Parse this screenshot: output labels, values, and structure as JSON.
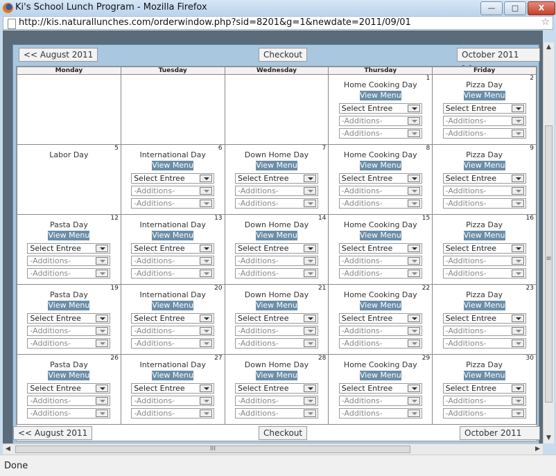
{
  "window": {
    "title": "Ki's School Lunch Program - Mozilla Firefox",
    "url": "http://kis.naturallunches.com/orderwindow.php?sid=8201&g=1&newdate=2011/09/01",
    "minimize_label": "—",
    "maximize_label": "□",
    "close_label": "X"
  },
  "nav": {
    "prev_label": "<< August 2011",
    "checkout_label": "Checkout",
    "next_label": "October 2011 >>"
  },
  "weekdays": [
    "Monday",
    "Tuesday",
    "Wednesday",
    "Thursday",
    "Friday"
  ],
  "labels": {
    "view_menu": "View Menu",
    "select_entree": "Select Entree",
    "additions": "-Additions-"
  },
  "weeks": [
    [
      {
        "day": "",
        "theme": "",
        "menu": false
      },
      {
        "day": "",
        "theme": "",
        "menu": false
      },
      {
        "day": "",
        "theme": "",
        "menu": false
      },
      {
        "day": "1",
        "theme": "Home Cooking Day",
        "menu": true
      },
      {
        "day": "2",
        "theme": "Pizza Day",
        "menu": true
      }
    ],
    [
      {
        "day": "5",
        "theme": "Labor Day",
        "menu": false
      },
      {
        "day": "6",
        "theme": "International Day",
        "menu": true
      },
      {
        "day": "7",
        "theme": "Down Home Day",
        "menu": true
      },
      {
        "day": "8",
        "theme": "Home Cooking Day",
        "menu": true
      },
      {
        "day": "9",
        "theme": "Pizza Day",
        "menu": true
      }
    ],
    [
      {
        "day": "12",
        "theme": "Pasta Day",
        "menu": true
      },
      {
        "day": "13",
        "theme": "International Day",
        "menu": true
      },
      {
        "day": "14",
        "theme": "Down Home Day",
        "menu": true
      },
      {
        "day": "15",
        "theme": "Home Cooking Day",
        "menu": true
      },
      {
        "day": "16",
        "theme": "Pizza Day",
        "menu": true
      }
    ],
    [
      {
        "day": "19",
        "theme": "Pasta Day",
        "menu": true
      },
      {
        "day": "20",
        "theme": "International Day",
        "menu": true
      },
      {
        "day": "21",
        "theme": "Down Home Day",
        "menu": true
      },
      {
        "day": "22",
        "theme": "Home Cooking Day",
        "menu": true
      },
      {
        "day": "23",
        "theme": "Pizza Day",
        "menu": true
      }
    ],
    [
      {
        "day": "26",
        "theme": "Pasta Day",
        "menu": true
      },
      {
        "day": "27",
        "theme": "International Day",
        "menu": true
      },
      {
        "day": "28",
        "theme": "Down Home Day",
        "menu": true
      },
      {
        "day": "29",
        "theme": "Home Cooking Day",
        "menu": true
      },
      {
        "day": "30",
        "theme": "Pizza Day",
        "menu": true
      }
    ]
  ],
  "status": {
    "text": "Done"
  },
  "scrollbar": {
    "h_grip": "III",
    "v_grip": "≡"
  }
}
